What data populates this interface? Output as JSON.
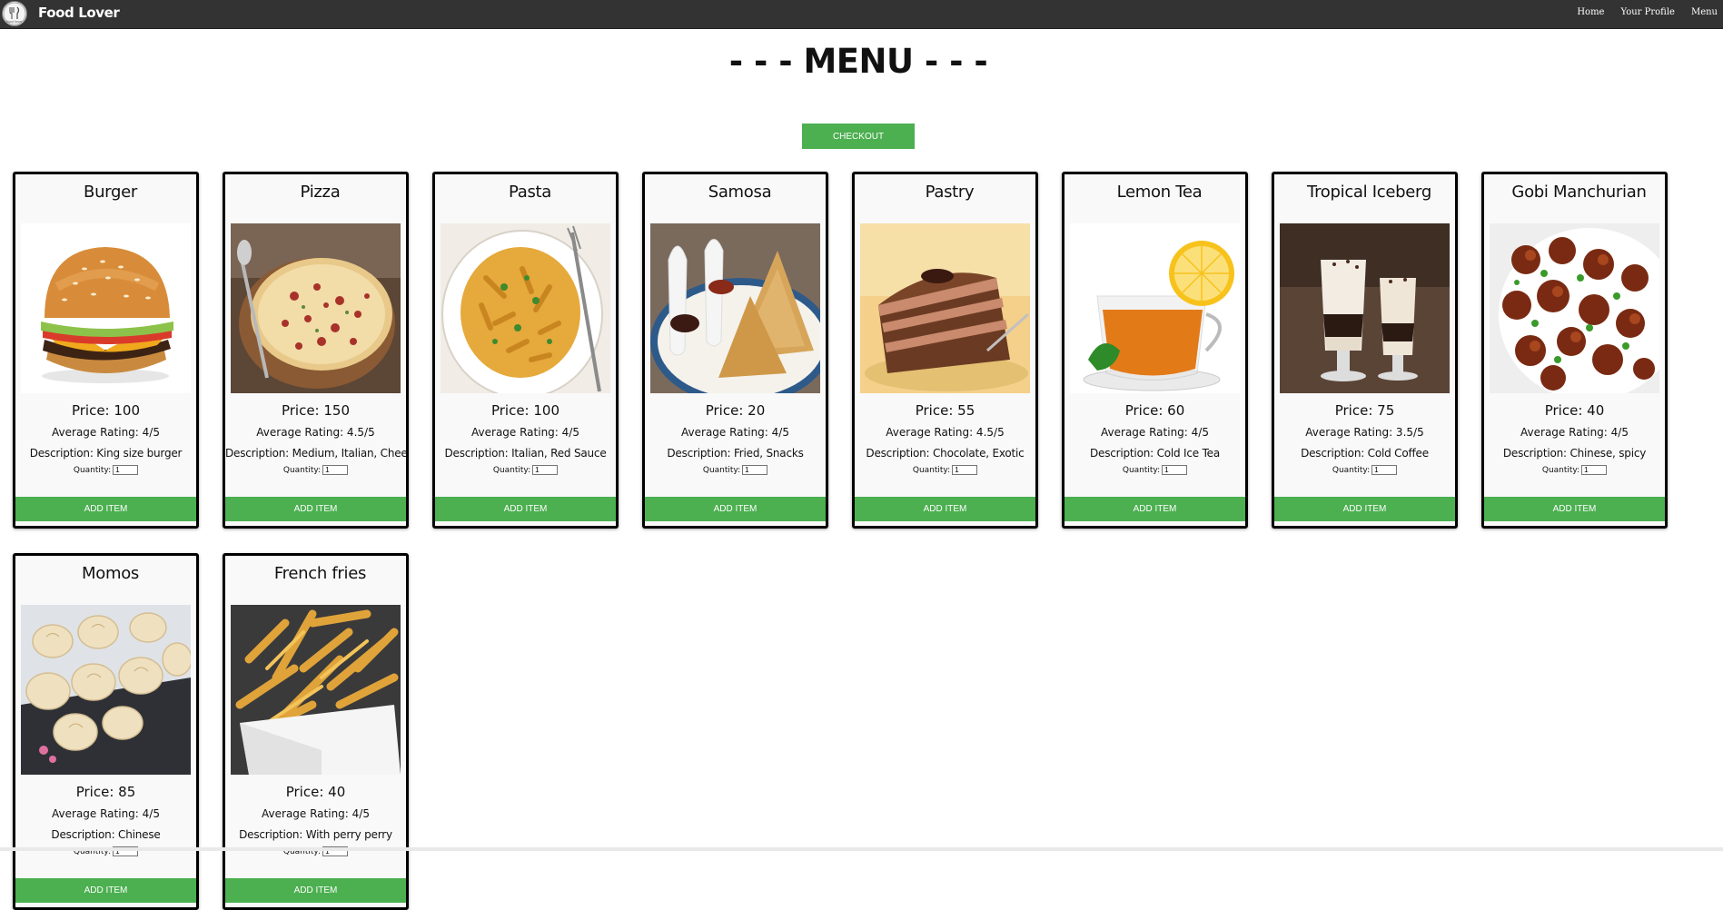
{
  "navbar": {
    "brand": "Food Lover",
    "links": [
      "Home",
      "Your Profile",
      "Menu"
    ],
    "logo_icon": "chef-logo-icon"
  },
  "page": {
    "title": "- - - MENU - - -",
    "checkout_label": "CHECKOUT",
    "accent_color": "#4caf50"
  },
  "labels": {
    "quantity": "Quantity:",
    "add_item": "ADD ITEM"
  },
  "items": [
    {
      "name": "Burger",
      "price": "Price: 100",
      "rating": "Average Rating: 4/5",
      "description": "Description: King size burger",
      "quantity": "1",
      "image": "burger-image"
    },
    {
      "name": "Pizza",
      "price": "Price: 150",
      "rating": "Average Rating: 4.5/5",
      "description": "Description: Medium, Italian, Cheezy",
      "quantity": "1",
      "image": "pizza-image"
    },
    {
      "name": "Pasta",
      "price": "Price: 100",
      "rating": "Average Rating: 4/5",
      "description": "Description: Italian, Red Sauce",
      "quantity": "1",
      "image": "pasta-image"
    },
    {
      "name": "Samosa",
      "price": "Price: 20",
      "rating": "Average Rating: 4/5",
      "description": "Description: Fried, Snacks",
      "quantity": "1",
      "image": "samosa-image"
    },
    {
      "name": "Pastry",
      "price": "Price: 55",
      "rating": "Average Rating: 4.5/5",
      "description": "Description: Chocolate, Exotic",
      "quantity": "1",
      "image": "pastry-image"
    },
    {
      "name": "Lemon Tea",
      "price": "Price: 60",
      "rating": "Average Rating: 4/5",
      "description": "Description: Cold Ice Tea",
      "quantity": "1",
      "image": "lemon-tea-image"
    },
    {
      "name": "Tropical Iceberg",
      "price": "Price: 75",
      "rating": "Average Rating: 3.5/5",
      "description": "Description: Cold Coffee",
      "quantity": "1",
      "image": "cold-coffee-image"
    },
    {
      "name": "Gobi Manchurian",
      "price": "Price: 40",
      "rating": "Average Rating: 4/5",
      "description": "Description: Chinese, spicy",
      "quantity": "1",
      "image": "gobi-manchurian-image"
    },
    {
      "name": "Momos",
      "price": "Price: 85",
      "rating": "Average Rating: 4/5",
      "description": "Description: Chinese",
      "quantity": "1",
      "image": "momos-image"
    },
    {
      "name": "French fries",
      "price": "Price: 40",
      "rating": "Average Rating: 4/5",
      "description": "Description: With perry perry",
      "quantity": "1",
      "image": "french-fries-image"
    }
  ]
}
